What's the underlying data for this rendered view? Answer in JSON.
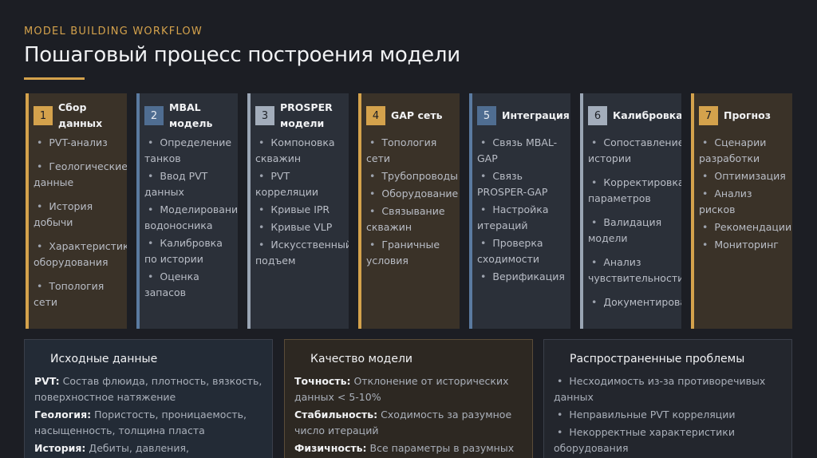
{
  "header": {
    "kicker": "MODEL BUILDING WORKFLOW",
    "title": "Пошаговый процесс построения модели",
    "accent_color": "#d4a24c"
  },
  "steps": [
    {
      "num": "1",
      "title": "Сбор данных",
      "color": "gold",
      "items": [
        "PVT-анализ",
        "Геологические данные",
        "История добычи",
        "Характеристики оборудования",
        "Топология сети"
      ]
    },
    {
      "num": "2",
      "title": "MBAL модель",
      "color": "blue",
      "items": [
        "Определение танков",
        "Ввод PVT данных",
        "Моделирование водоносника",
        "Калибровка по истории",
        "Оценка запасов"
      ]
    },
    {
      "num": "3",
      "title": "PROSPER модели",
      "color": "grey",
      "items": [
        "Компоновка скважин",
        "PVT корреляции",
        "Кривые IPR",
        "Кривые VLP",
        "Искусственный подъем"
      ]
    },
    {
      "num": "4",
      "title": "GAP сеть",
      "color": "gold",
      "items": [
        "Топология сети",
        "Трубопроводы",
        "Оборудование",
        "Связывание скважин",
        "Граничные условия"
      ]
    },
    {
      "num": "5",
      "title": "Интеграция",
      "color": "blue",
      "items": [
        "Связь MBAL-GAP",
        "Связь PROSPER-GAP",
        "Настройка итераций",
        "Проверка сходимости",
        "Верификация"
      ]
    },
    {
      "num": "6",
      "title": "Калибровка",
      "color": "grey",
      "items": [
        "Сопоставление истории",
        "Корректировка параметров",
        "Валидация модели",
        "Анализ чувствительности",
        "Документирование"
      ]
    },
    {
      "num": "7",
      "title": "Прогноз",
      "color": "gold",
      "items": [
        "Сценарии разработки",
        "Оптимизация",
        "Анализ рисков",
        "Рекомендации",
        "Мониторинг"
      ]
    }
  ],
  "panels": {
    "inputs": {
      "title": "Исходные данные",
      "rows": [
        {
          "k": "PVT:",
          "v": "Состав флюида, плотность, вязкость, поверхностное натяжение"
        },
        {
          "k": "Геология:",
          "v": "Пористость, проницаемость, насыщенность, толщина пласта"
        },
        {
          "k": "История:",
          "v": "Дебиты, давления, обводненность,"
        }
      ]
    },
    "quality": {
      "title": "Качество модели",
      "rows": [
        {
          "k": "Точность:",
          "v": "Отклонение от исторических данных < 5-10%"
        },
        {
          "k": "Стабильность:",
          "v": "Сходимость за разумное число итераций"
        },
        {
          "k": "Физичность:",
          "v": "Все параметры в разумных"
        }
      ]
    },
    "problems": {
      "title": "Распространенные проблемы",
      "items": [
        "Несходимость из-за противоречивых данных",
        "Неправильные PVT корреляции",
        "Некорректные характеристики оборудования"
      ]
    }
  }
}
